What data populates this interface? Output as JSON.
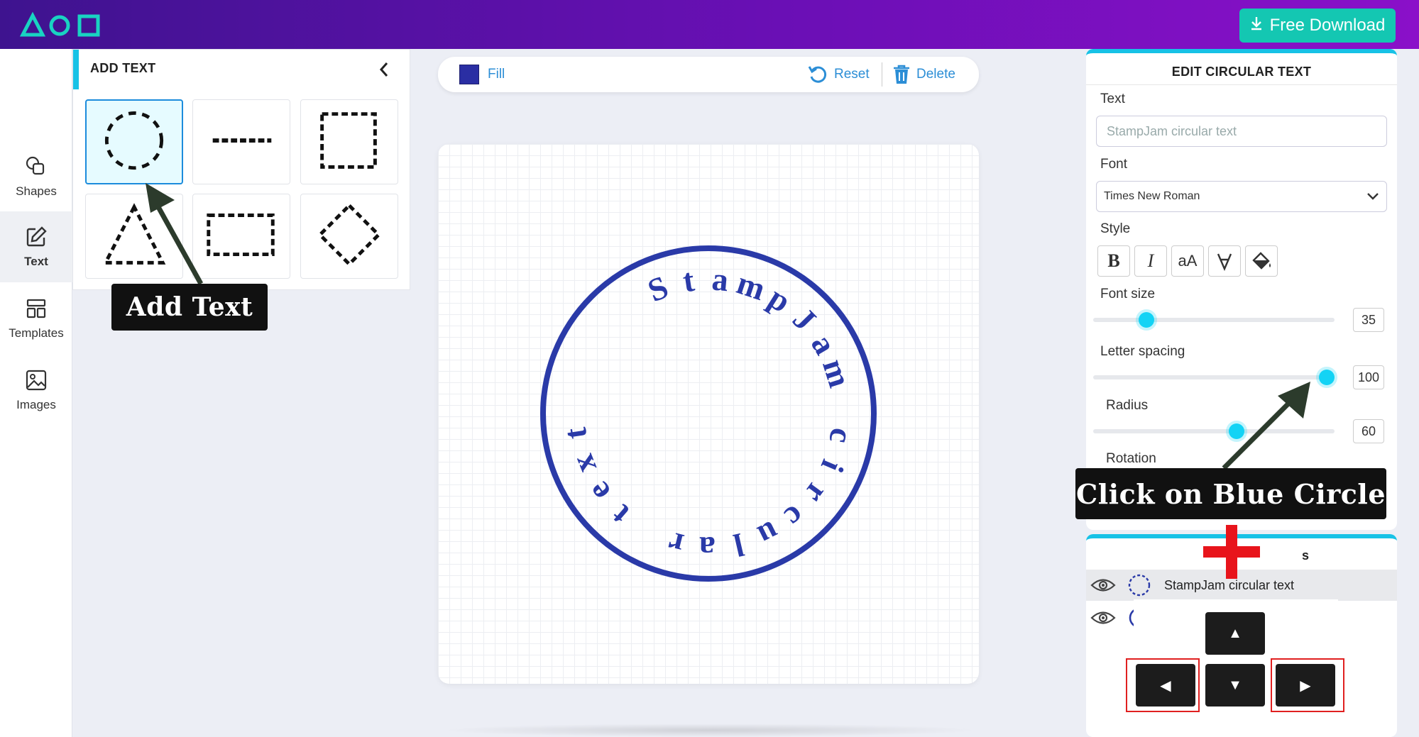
{
  "header": {
    "download_label": "Free Download",
    "brand_color": "#6a0fb5",
    "download_color": "#14c7b2"
  },
  "leftnav": {
    "items": [
      {
        "label": "Shapes",
        "icon": "shapes-icon"
      },
      {
        "label": "Text",
        "icon": "edit-text-icon",
        "active": true
      },
      {
        "label": "Templates",
        "icon": "templates-icon"
      },
      {
        "label": "Images",
        "icon": "image-icon"
      }
    ]
  },
  "add_text_panel": {
    "title": "ADD TEXT",
    "shapes": [
      "dashed-circle",
      "dashed-line",
      "dashed-square",
      "dashed-triangle",
      "dashed-rectangle",
      "dashed-diamond"
    ],
    "selected": "dashed-circle"
  },
  "toolbar": {
    "fill_label": "Fill",
    "fill_color": "#2a2ea3",
    "reset_label": "Reset",
    "delete_label": "Delete"
  },
  "canvas": {
    "circular_text": "StampJam circular text",
    "stamp_color": "#2a3aa8"
  },
  "edit_panel": {
    "title": "EDIT CIRCULAR TEXT",
    "text_label": "Text",
    "text_placeholder": "StampJam circular text",
    "font_label": "Font",
    "font_value": "Times New Roman",
    "style_label": "Style",
    "font_size_label": "Font size",
    "font_size_value": "35",
    "letter_spacing_label": "Letter spacing",
    "letter_spacing_value": "100",
    "radius_label": "Radius",
    "radius_value": "60",
    "rotation_label": "Rotation",
    "accent_color": "#13d3f5"
  },
  "layers_panel": {
    "title_visible": "s",
    "rows": [
      {
        "label": "StampJam circular text",
        "selected": true
      },
      {
        "label": "",
        "selected": false
      }
    ]
  },
  "annotations": {
    "add_text": "Add Text",
    "click_blue_circle": "Click on Blue Circle"
  }
}
